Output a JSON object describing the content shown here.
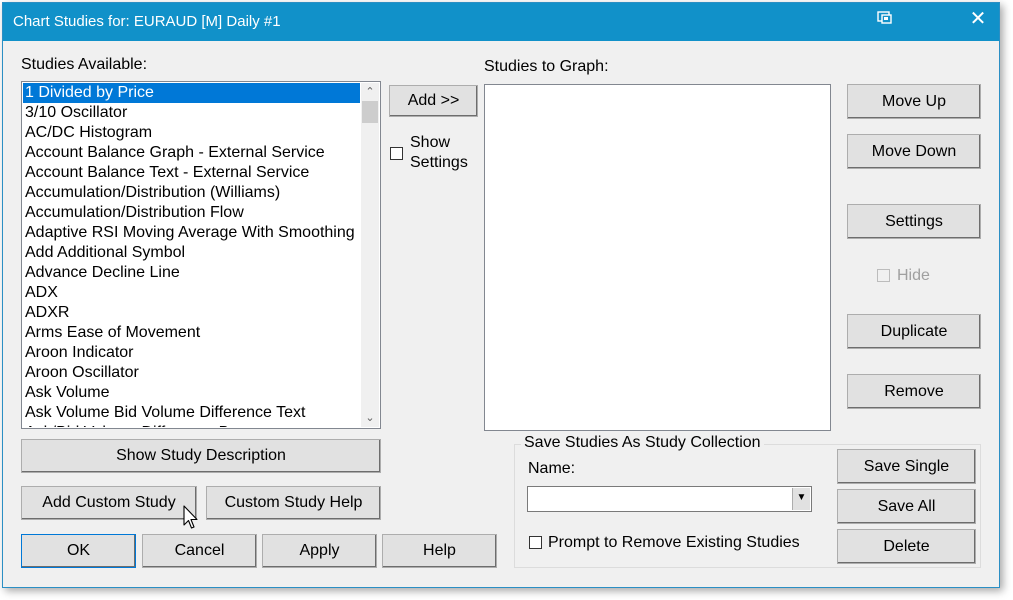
{
  "window": {
    "title": "Chart Studies for: EURAUD [M]  Daily  #1",
    "close_glyph": "✕"
  },
  "studies_available": {
    "label": "Studies Available:",
    "items": [
      "1 Divided by Price",
      "3/10 Oscillator",
      "AC/DC Histogram",
      "Account Balance Graph - External Service",
      "Account Balance Text - External Service",
      "Accumulation/Distribution (Williams)",
      "Accumulation/Distribution Flow",
      "Adaptive RSI Moving Average With Smoothing",
      "Add Additional Symbol",
      "Advance Decline Line",
      "ADX",
      "ADXR",
      "Arms Ease of Movement",
      "Aroon Indicator",
      "Aroon Oscillator",
      "Ask Volume",
      "Ask Volume Bid Volume Difference Text",
      "Ask/Bid Volume Difference Bars"
    ],
    "selected_index": 0
  },
  "add_button": "Add >>",
  "show_settings": {
    "label_line1": "Show",
    "label_line2": "Settings",
    "checked": false
  },
  "studies_to_graph": {
    "label": "Studies to Graph:",
    "items": []
  },
  "right_buttons": {
    "move_up": "Move Up",
    "move_down": "Move Down",
    "settings": "Settings",
    "hide_label": "Hide",
    "duplicate": "Duplicate",
    "remove": "Remove"
  },
  "bottom_left": {
    "show_study_description": "Show Study Description",
    "add_custom_study": "Add Custom Study",
    "custom_study_help": "Custom Study Help",
    "ok": "OK",
    "cancel": "Cancel",
    "apply": "Apply",
    "help": "Help"
  },
  "save_group": {
    "title": "Save Studies As Study Collection",
    "name_label": "Name:",
    "name_value": "",
    "prompt_label": "Prompt to Remove Existing Studies",
    "prompt_checked": false,
    "save_single": "Save Single",
    "save_all": "Save All",
    "delete": "Delete"
  },
  "colors": {
    "titlebar": "#1191c9",
    "selection": "#0078d7",
    "dialog_bg": "#f0f0f0"
  }
}
